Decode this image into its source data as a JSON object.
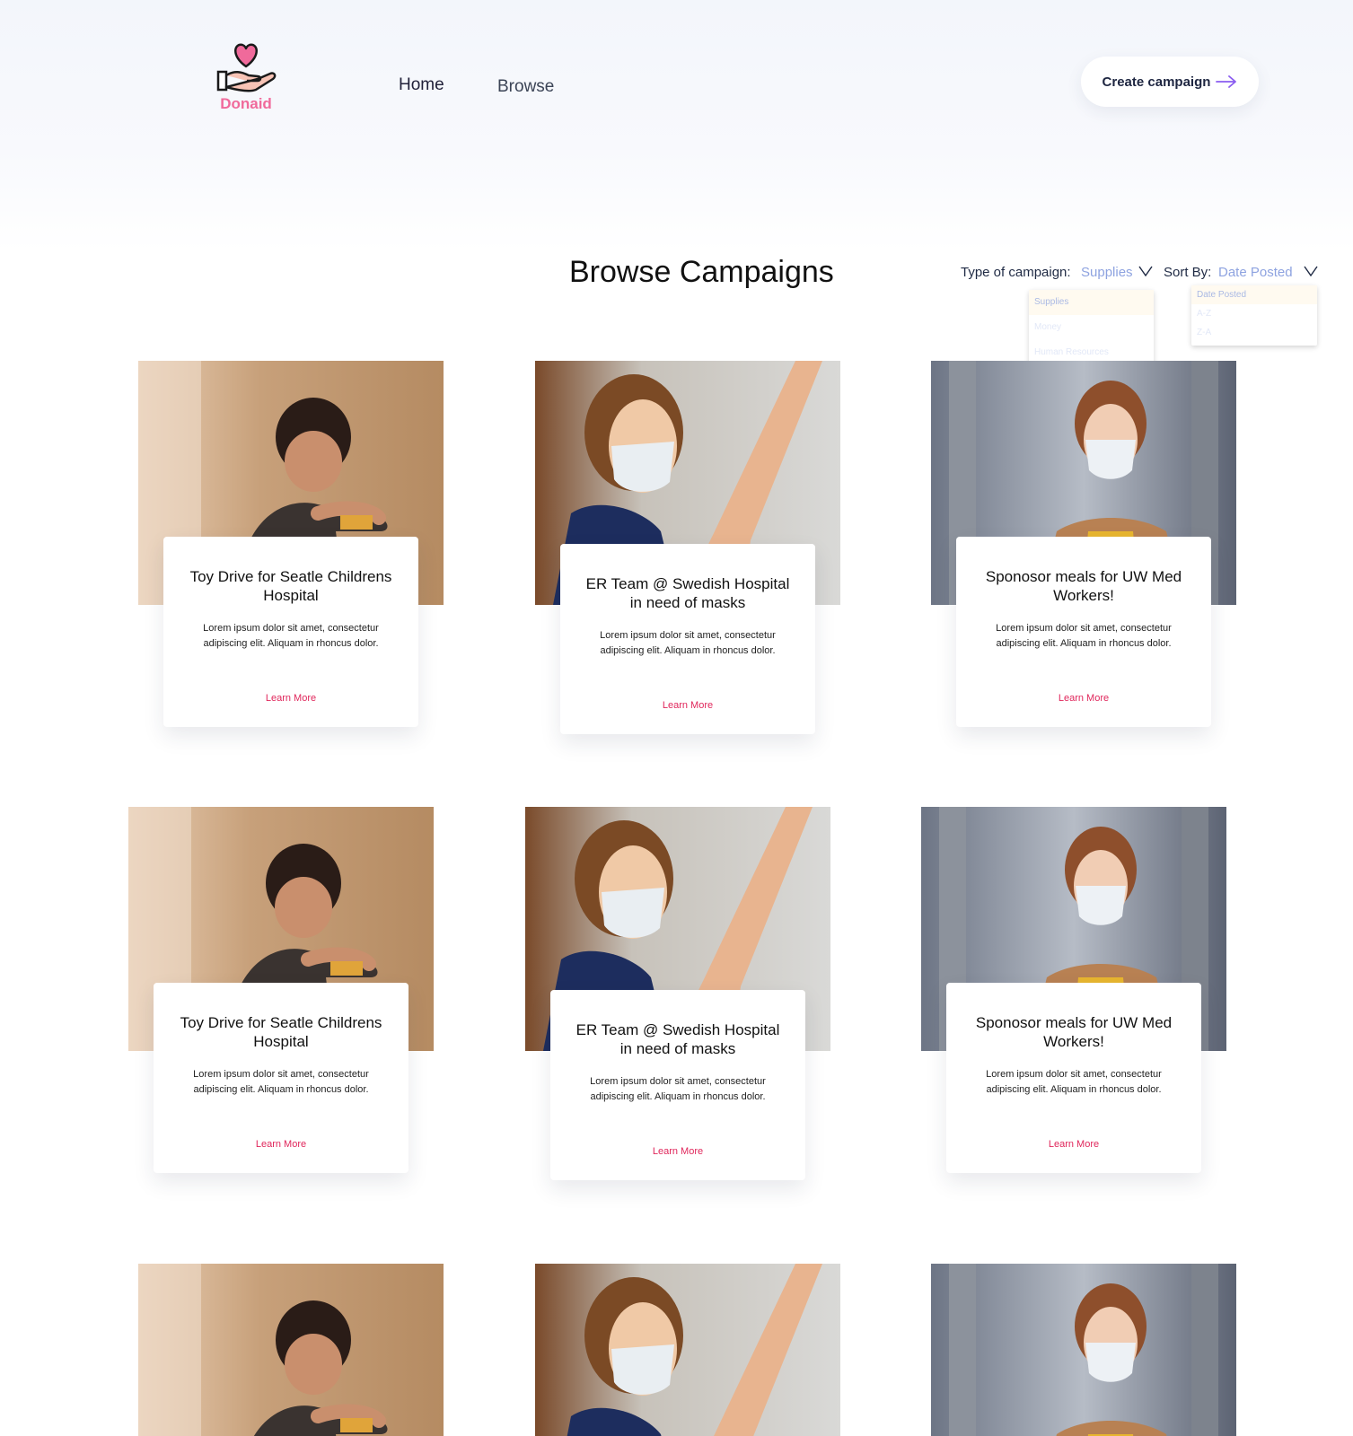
{
  "brand": {
    "name": "Donaid"
  },
  "nav": {
    "home": "Home",
    "browse": "Browse"
  },
  "header": {
    "cta": "Create campaign"
  },
  "page": {
    "title": "Browse Campaigns"
  },
  "filters": {
    "type": {
      "label": "Type of campaign:",
      "value": "Supplies",
      "options": [
        "Supplies",
        "Money",
        "Human Resources"
      ]
    },
    "sort": {
      "label": "Sort By:",
      "value": "Date Posted",
      "options": [
        "Date Posted",
        "A-Z",
        "Z-A"
      ]
    }
  },
  "campaigns": [
    {
      "title": "Toy Drive for Seatle Childrens Hospital",
      "description": "Lorem ipsum dolor sit amet, consectetur adipiscing elit. Aliquam in rhoncus dolor.",
      "link": "Learn More",
      "image": "child-with-toy-photo"
    },
    {
      "title": "ER Team @ Swedish Hospital in need of masks",
      "description": "Lorem ipsum dolor sit amet, consectetur adipiscing elit. Aliquam in rhoncus dolor.",
      "link": "Learn More",
      "image": "masked-nurse-photo"
    },
    {
      "title": "Sponosor meals for UW Med Workers!",
      "description": "Lorem ipsum dolor sit amet, consectetur adipiscing elit. Aliquam in rhoncus dolor.",
      "link": "Learn More",
      "image": "masked-woman-photo"
    },
    {
      "title": "Toy Drive for Seatle Childrens Hospital",
      "description": "Lorem ipsum dolor sit amet, consectetur adipiscing elit. Aliquam in rhoncus dolor.",
      "link": "Learn More",
      "image": "child-with-toy-photo"
    },
    {
      "title": "ER Team @ Swedish Hospital in need of masks",
      "description": "Lorem ipsum dolor sit amet, consectetur adipiscing elit. Aliquam in rhoncus dolor.",
      "link": "Learn More",
      "image": "masked-nurse-photo"
    },
    {
      "title": "Sponosor meals for UW Med Workers!",
      "description": "Lorem ipsum dolor sit amet, consectetur adipiscing elit. Aliquam in rhoncus dolor.",
      "link": "Learn More",
      "image": "masked-woman-photo"
    },
    {
      "image": "child-with-toy-photo"
    },
    {
      "image": "masked-nurse-photo"
    },
    {
      "image": "masked-woman-photo"
    }
  ],
  "colors": {
    "accent": "#e0265b",
    "brand": "#f06a9b",
    "muted_link": "#8ea3e0"
  }
}
